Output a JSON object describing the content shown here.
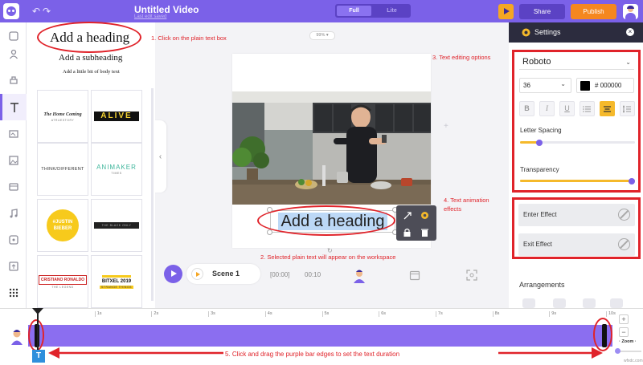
{
  "app": {
    "title": "Untitled Video",
    "subtitle": "Last edit saved",
    "mode_full": "Full",
    "mode_lite": "Lite",
    "share_label": "Share",
    "publish_label": "Publish",
    "accent_color": "#7b61e8",
    "publish_color": "#f5871f"
  },
  "library": {
    "heading": "Add a heading",
    "subheading": "Add a subheading",
    "body": "Add a little bit of body text",
    "tiles": [
      {
        "title": "The Home Coming",
        "sub": "ATRUESTORY"
      },
      {
        "title": "ALIVE",
        "sub": ""
      },
      {
        "title": "THINK/DIFFERENT",
        "sub": ""
      },
      {
        "title": "ANIMAKER",
        "sub": "TIMES"
      },
      {
        "title": "#JUSTIN BIEBER",
        "sub": ""
      },
      {
        "title": "THE BLACK ONLY",
        "sub": ""
      },
      {
        "title": "CRISTIANO RONALDO",
        "sub": "THE LEGEND"
      },
      {
        "title": "BITXEL 2019",
        "sub": "STRANGE THINGS"
      }
    ]
  },
  "workspace": {
    "zoom": "99%",
    "selected_text": "Add a heading",
    "scene_label": "Scene 1",
    "time_current": "[00:00]",
    "time_total": "00:10"
  },
  "settings": {
    "title": "Settings",
    "font": "Roboto",
    "font_size": "36",
    "color_hex": "000000",
    "color_prefix": "#",
    "letter_spacing_label": "Letter Spacing",
    "letter_spacing_value": 0.17,
    "transparency_label": "Transparency",
    "transparency_value": 1.0,
    "enter_effect": "Enter Effect",
    "exit_effect": "Exit Effect",
    "arrangements": "Arrangements",
    "format_buttons": [
      "B",
      "I",
      "U",
      "list",
      "align",
      "spacing"
    ]
  },
  "timeline": {
    "ticks": [
      "1s",
      "2s",
      "3s",
      "4s",
      "5s",
      "6s",
      "7s",
      "8s",
      "9s",
      "10s"
    ],
    "zoom_label": "Zoom",
    "text_chip": "T",
    "watermark": "wfxdc.com"
  },
  "annotations": {
    "step1": "1. Click on the plain text box",
    "step2": "2. Selected plain text will appear on the workspace",
    "step3": "3. Text editing options",
    "step4": "4. Text animation effects",
    "step5": "5. Click and drag the purple bar edges to set the text duration"
  }
}
